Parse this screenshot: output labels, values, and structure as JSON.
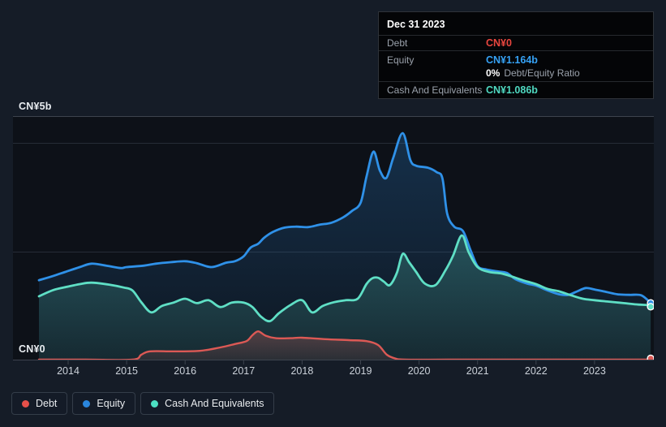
{
  "tooltip": {
    "date": "Dec 31 2023",
    "debt": {
      "label": "Debt",
      "value": "CN¥0"
    },
    "equity": {
      "label": "Equity",
      "value": "CN¥1.164b"
    },
    "ratio": {
      "pct": "0%",
      "text": "Debt/Equity Ratio"
    },
    "cash": {
      "label": "Cash And Equivalents",
      "value": "CN¥1.086b"
    }
  },
  "legend": {
    "items": [
      {
        "label": "Debt",
        "color": "#e6504a"
      },
      {
        "label": "Equity",
        "color": "#2a86dd"
      },
      {
        "label": "Cash And Equivalents",
        "color": "#4cdfc2"
      }
    ]
  },
  "colors": {
    "background": "#151c27",
    "plot_background": "#0d1118",
    "grid_strong": "#3d434e",
    "grid_faint": "#262c36",
    "debt_line": "#dc5955",
    "equity_line": "#2f91e8",
    "cash_line": "#5fdfc5",
    "debt_value_text": "#e8463f",
    "equity_value_text": "#36a2f5",
    "cash_value_text": "#4fd9c1"
  },
  "chart_data": {
    "type": "area",
    "unit": "CN¥ billions",
    "ylabel_top": "CN¥5b",
    "ylabel_bottom": "CN¥0",
    "ylim": [
      0,
      5
    ],
    "x_domain": [
      2013.5,
      2024.0
    ],
    "x_tick_years": [
      "2014",
      "2015",
      "2016",
      "2017",
      "2018",
      "2019",
      "2020",
      "2021",
      "2022",
      "2023"
    ],
    "legend_position": "bottom-left",
    "final_values": {
      "debt_b": 0,
      "equity_b": 1.164,
      "cash_b": 1.086,
      "debt_equity_ratio_pct": 0
    },
    "series": [
      {
        "name": "Debt",
        "color": "#dc5955",
        "points": [
          [
            2013.5,
            0
          ],
          [
            2014.3,
            0
          ],
          [
            2015.1,
            0
          ],
          [
            2015.25,
            0.1
          ],
          [
            2015.4,
            0.17
          ],
          [
            2015.8,
            0.17
          ],
          [
            2016.25,
            0.18
          ],
          [
            2016.6,
            0.25
          ],
          [
            2016.85,
            0.32
          ],
          [
            2017.05,
            0.38
          ],
          [
            2017.15,
            0.5
          ],
          [
            2017.25,
            0.58
          ],
          [
            2017.38,
            0.49
          ],
          [
            2017.55,
            0.44
          ],
          [
            2017.8,
            0.44
          ],
          [
            2018.0,
            0.45
          ],
          [
            2018.4,
            0.42
          ],
          [
            2018.8,
            0.4
          ],
          [
            2019.1,
            0.38
          ],
          [
            2019.3,
            0.3
          ],
          [
            2019.45,
            0.1
          ],
          [
            2019.6,
            0.02
          ],
          [
            2019.75,
            0
          ],
          [
            2020.5,
            0
          ],
          [
            2021.5,
            0
          ],
          [
            2022.5,
            0
          ],
          [
            2023.96,
            0
          ]
        ]
      },
      {
        "name": "Equity",
        "color": "#2f91e8",
        "points": [
          [
            2013.5,
            1.63
          ],
          [
            2013.75,
            1.72
          ],
          [
            2013.95,
            1.8
          ],
          [
            2014.2,
            1.9
          ],
          [
            2014.4,
            1.97
          ],
          [
            2014.65,
            1.93
          ],
          [
            2014.9,
            1.88
          ],
          [
            2015.0,
            1.9
          ],
          [
            2015.3,
            1.93
          ],
          [
            2015.5,
            1.97
          ],
          [
            2015.75,
            2.0
          ],
          [
            2016.0,
            2.02
          ],
          [
            2016.2,
            1.98
          ],
          [
            2016.45,
            1.9
          ],
          [
            2016.7,
            1.99
          ],
          [
            2016.85,
            2.02
          ],
          [
            2017.0,
            2.12
          ],
          [
            2017.12,
            2.3
          ],
          [
            2017.25,
            2.38
          ],
          [
            2017.35,
            2.5
          ],
          [
            2017.5,
            2.62
          ],
          [
            2017.7,
            2.71
          ],
          [
            2017.9,
            2.73
          ],
          [
            2018.1,
            2.72
          ],
          [
            2018.3,
            2.77
          ],
          [
            2018.5,
            2.81
          ],
          [
            2018.7,
            2.92
          ],
          [
            2018.85,
            3.05
          ],
          [
            2019.0,
            3.22
          ],
          [
            2019.1,
            3.75
          ],
          [
            2019.22,
            4.27
          ],
          [
            2019.33,
            3.88
          ],
          [
            2019.44,
            3.73
          ],
          [
            2019.56,
            4.15
          ],
          [
            2019.72,
            4.65
          ],
          [
            2019.85,
            4.1
          ],
          [
            2019.95,
            3.98
          ],
          [
            2020.15,
            3.94
          ],
          [
            2020.3,
            3.85
          ],
          [
            2020.4,
            3.72
          ],
          [
            2020.48,
            3.0
          ],
          [
            2020.6,
            2.73
          ],
          [
            2020.75,
            2.64
          ],
          [
            2020.88,
            2.25
          ],
          [
            2021.0,
            1.92
          ],
          [
            2021.15,
            1.85
          ],
          [
            2021.35,
            1.81
          ],
          [
            2021.5,
            1.78
          ],
          [
            2021.65,
            1.65
          ],
          [
            2021.85,
            1.56
          ],
          [
            2022.0,
            1.52
          ],
          [
            2022.2,
            1.42
          ],
          [
            2022.4,
            1.34
          ],
          [
            2022.55,
            1.33
          ],
          [
            2022.7,
            1.4
          ],
          [
            2022.85,
            1.47
          ],
          [
            2023.0,
            1.44
          ],
          [
            2023.2,
            1.39
          ],
          [
            2023.4,
            1.34
          ],
          [
            2023.6,
            1.33
          ],
          [
            2023.8,
            1.32
          ],
          [
            2023.96,
            1.164
          ]
        ]
      },
      {
        "name": "Cash And Equivalents",
        "color": "#5fdfc5",
        "points": [
          [
            2013.5,
            1.3
          ],
          [
            2013.75,
            1.43
          ],
          [
            2014.0,
            1.5
          ],
          [
            2014.2,
            1.55
          ],
          [
            2014.4,
            1.58
          ],
          [
            2014.7,
            1.54
          ],
          [
            2014.95,
            1.48
          ],
          [
            2015.1,
            1.42
          ],
          [
            2015.25,
            1.18
          ],
          [
            2015.42,
            0.97
          ],
          [
            2015.6,
            1.1
          ],
          [
            2015.8,
            1.17
          ],
          [
            2016.0,
            1.25
          ],
          [
            2016.2,
            1.16
          ],
          [
            2016.4,
            1.22
          ],
          [
            2016.6,
            1.08
          ],
          [
            2016.8,
            1.17
          ],
          [
            2017.0,
            1.17
          ],
          [
            2017.15,
            1.08
          ],
          [
            2017.3,
            0.88
          ],
          [
            2017.45,
            0.79
          ],
          [
            2017.6,
            0.95
          ],
          [
            2017.8,
            1.12
          ],
          [
            2018.0,
            1.22
          ],
          [
            2018.17,
            0.97
          ],
          [
            2018.35,
            1.1
          ],
          [
            2018.55,
            1.18
          ],
          [
            2018.75,
            1.22
          ],
          [
            2018.95,
            1.25
          ],
          [
            2019.1,
            1.55
          ],
          [
            2019.2,
            1.67
          ],
          [
            2019.3,
            1.68
          ],
          [
            2019.4,
            1.6
          ],
          [
            2019.5,
            1.53
          ],
          [
            2019.62,
            1.78
          ],
          [
            2019.72,
            2.17
          ],
          [
            2019.83,
            2.0
          ],
          [
            2019.95,
            1.8
          ],
          [
            2020.1,
            1.56
          ],
          [
            2020.28,
            1.53
          ],
          [
            2020.45,
            1.83
          ],
          [
            2020.58,
            2.13
          ],
          [
            2020.73,
            2.55
          ],
          [
            2020.85,
            2.2
          ],
          [
            2021.0,
            1.9
          ],
          [
            2021.2,
            1.8
          ],
          [
            2021.4,
            1.77
          ],
          [
            2021.6,
            1.7
          ],
          [
            2021.8,
            1.62
          ],
          [
            2022.0,
            1.55
          ],
          [
            2022.2,
            1.45
          ],
          [
            2022.4,
            1.4
          ],
          [
            2022.6,
            1.32
          ],
          [
            2022.8,
            1.25
          ],
          [
            2023.0,
            1.22
          ],
          [
            2023.25,
            1.19
          ],
          [
            2023.5,
            1.16
          ],
          [
            2023.75,
            1.13
          ],
          [
            2023.9,
            1.12
          ],
          [
            2023.96,
            1.086
          ]
        ]
      }
    ]
  }
}
